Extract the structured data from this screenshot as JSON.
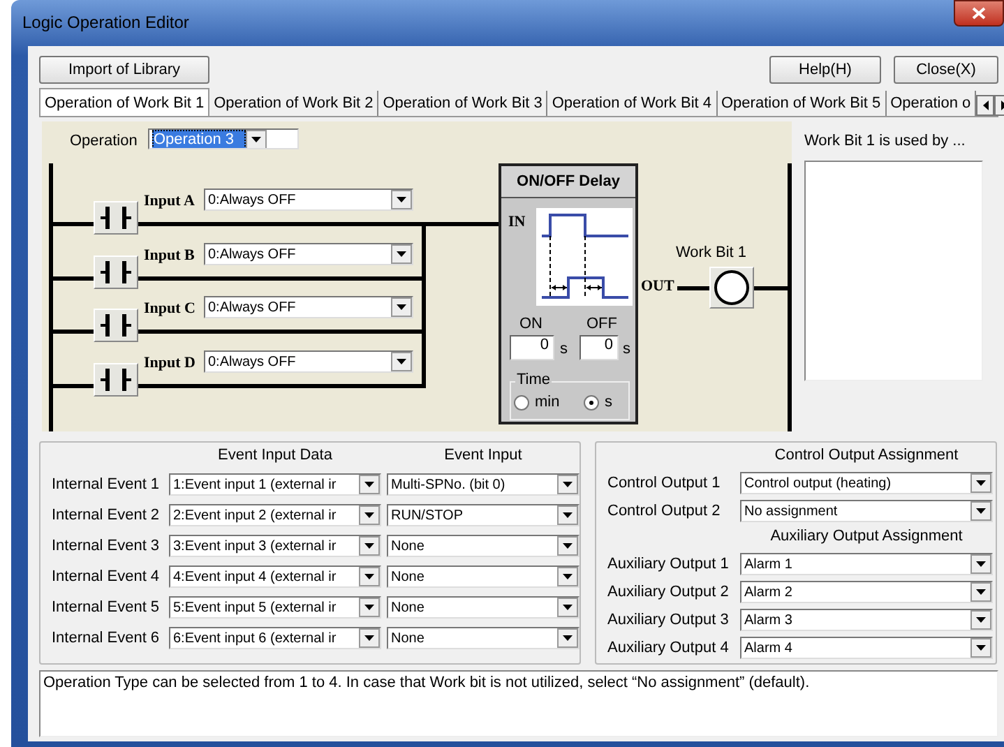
{
  "window": {
    "title": "Logic Operation Editor"
  },
  "buttons": {
    "import": "Import of Library",
    "help": "Help(H)",
    "close": "Close(X)"
  },
  "tabs": [
    {
      "label": "Operation of Work Bit 1",
      "selected": true
    },
    {
      "label": "Operation of Work Bit 2",
      "selected": false
    },
    {
      "label": "Operation of Work Bit 3",
      "selected": false
    },
    {
      "label": "Operation of Work Bit 4",
      "selected": false
    },
    {
      "label": "Operation of Work Bit 5",
      "selected": false
    },
    {
      "label": "Operation o",
      "selected": false
    }
  ],
  "operation": {
    "label": "Operation",
    "value": "Operation 3"
  },
  "inputs": [
    {
      "label": "Input A",
      "value": "0:Always OFF"
    },
    {
      "label": "Input B",
      "value": "0:Always OFF"
    },
    {
      "label": "Input C",
      "value": "0:Always OFF"
    },
    {
      "label": "Input D",
      "value": "0:Always OFF"
    }
  ],
  "delay_block": {
    "title": "ON/OFF Delay",
    "in_label": "IN",
    "out_label": "OUT",
    "on_label": "ON",
    "on_value": "0",
    "on_unit": "s",
    "off_label": "OFF",
    "off_value": "0",
    "off_unit": "s",
    "time_label": "Time",
    "time_options": [
      {
        "label": "min",
        "selected": false
      },
      {
        "label": "s",
        "selected": true
      }
    ]
  },
  "coil": {
    "label": "Work Bit 1"
  },
  "used_by": {
    "title": "Work Bit 1 is used by ..."
  },
  "internal_events": {
    "headers": [
      "Event Input Data",
      "Event Input"
    ],
    "rows": [
      {
        "label": "Internal Event 1",
        "data": "1:Event input 1 (external ir",
        "input": "Multi-SPNo. (bit 0)"
      },
      {
        "label": "Internal Event 2",
        "data": "2:Event input 2 (external ir",
        "input": "RUN/STOP"
      },
      {
        "label": "Internal Event 3",
        "data": "3:Event input 3 (external ir",
        "input": "None"
      },
      {
        "label": "Internal Event 4",
        "data": "4:Event input 4 (external ir",
        "input": "None"
      },
      {
        "label": "Internal Event 5",
        "data": "5:Event input 5 (external ir",
        "input": "None"
      },
      {
        "label": "Internal Event 6",
        "data": "6:Event input 6 (external ir",
        "input": "None"
      }
    ]
  },
  "outputs": {
    "control_title": "Control Output Assignment",
    "control": [
      {
        "label": "Control Output 1",
        "value": "Control output (heating)"
      },
      {
        "label": "Control Output 2",
        "value": "No assignment"
      }
    ],
    "aux_title": "Auxiliary Output Assignment",
    "aux": [
      {
        "label": "Auxiliary Output 1",
        "value": "Alarm 1"
      },
      {
        "label": "Auxiliary Output 2",
        "value": "Alarm 2"
      },
      {
        "label": "Auxiliary Output 3",
        "value": "Alarm 3"
      },
      {
        "label": "Auxiliary Output 4",
        "value": "Alarm 4"
      }
    ]
  },
  "message": "Operation Type can be selected from 1 to 4. In case that Work bit is not utilized, select “No assignment” (default)."
}
